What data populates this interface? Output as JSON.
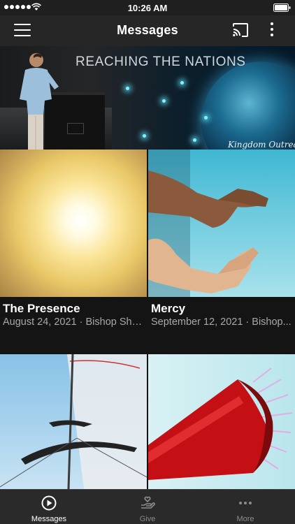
{
  "status_bar": {
    "time": "10:26 AM",
    "icons": [
      "signal-dots",
      "wifi-icon",
      "battery-icon"
    ]
  },
  "nav": {
    "title": "Messages",
    "icons": [
      "menu-icon",
      "cast-icon",
      "more-vert-icon"
    ]
  },
  "hero": {
    "title": "REACHING THE NATIONS",
    "signature": "Kingdom Outreach"
  },
  "messages": [
    {
      "title": "The Presence",
      "subtitle": "August 24, 2021 · Bishop Sha..."
    },
    {
      "title": "Mercy",
      "subtitle": "September 12, 2021 · Bishop..."
    },
    {
      "title": "",
      "subtitle": ""
    },
    {
      "title": "",
      "subtitle": ""
    }
  ],
  "tabs": [
    {
      "label": "Messages",
      "icon": "play-circle-icon",
      "active": true
    },
    {
      "label": "Give",
      "icon": "give-hand-icon",
      "active": false
    },
    {
      "label": "More",
      "icon": "more-horiz-icon",
      "active": false
    }
  ],
  "colors": {
    "background": "#141414",
    "nav_bar": "#262626",
    "tab_bar": "#2a2a2a",
    "subtitle": "#a8a8a8",
    "inactive_tab": "#8c8c8c"
  }
}
